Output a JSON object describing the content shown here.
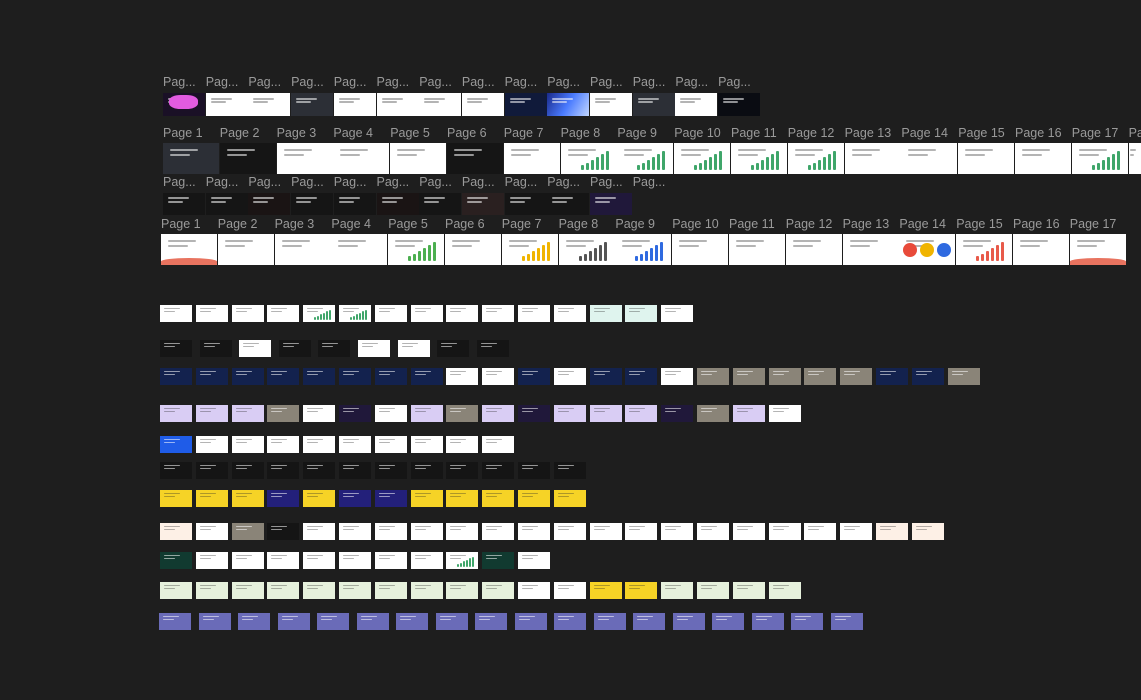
{
  "canvas": {
    "background": "#1e1e1e",
    "label_color": "#9a9a9a"
  },
  "frame_rows": [
    {
      "name": "row-1",
      "labels": [
        "Pag...",
        "Pag...",
        "Pag...",
        "Pag...",
        "Pag...",
        "Pag...",
        "Pag...",
        "Pag...",
        "Pag...",
        "Pag...",
        "Pag...",
        "Pag...",
        "Pag...",
        "Pag..."
      ],
      "thumb_themes": [
        "pink-dark",
        "light",
        "light",
        "photo-dark",
        "light",
        "light",
        "light",
        "light",
        "blue-dark",
        "blue-gradient",
        "light",
        "photo-dark",
        "light",
        "space-dark"
      ]
    },
    {
      "name": "row-2",
      "labels": [
        "Page 1",
        "Page 2",
        "Page 3",
        "Page 4",
        "Page 5",
        "Page 6",
        "Page 7",
        "Page 8",
        "Page 9",
        "Page 10",
        "Page 11",
        "Page 12",
        "Page 13",
        "Page 14",
        "Page 15",
        "Page 16",
        "Page 17",
        "Pa"
      ],
      "thumb_themes": [
        "photo-dark",
        "dark",
        "light",
        "light",
        "light",
        "dark",
        "light",
        "light-chart",
        "light-chart",
        "light-chart",
        "light-chart",
        "light-chart",
        "light",
        "light",
        "light",
        "light",
        "light-chart",
        "light"
      ]
    },
    {
      "name": "row-3",
      "labels": [
        "Pag...",
        "Pag...",
        "Pag...",
        "Pag...",
        "Pag...",
        "Pag...",
        "Pag...",
        "Pag...",
        "Pag...",
        "Pag...",
        "Pag...",
        "Pag..."
      ],
      "thumb_themes": [
        "dark",
        "dark",
        "dark-red",
        "dark",
        "dark",
        "dark-red",
        "dark",
        "red-green",
        "dark",
        "dark",
        "purple-dark"
      ]
    },
    {
      "name": "row-4",
      "labels": [
        "Page 1",
        "Page 2",
        "Page 3",
        "Page 4",
        "Page 5",
        "Page 6",
        "Page 7",
        "Page 8",
        "Page 9",
        "Page 10",
        "Page 11",
        "Page 12",
        "Page 13",
        "Page 14",
        "Page 15",
        "Page 16",
        "Page 17"
      ],
      "thumb_themes": [
        "coral-wave",
        "light",
        "light",
        "light",
        "green-bars",
        "light",
        "yellow-bars",
        "mono-bars",
        "blue-bars",
        "light",
        "light",
        "light",
        "light",
        "circles",
        "coral-bars",
        "people",
        "coral-wave"
      ]
    }
  ],
  "slide_rows": [
    {
      "name": "deck-a",
      "thumb_themes": [
        "light",
        "light",
        "light",
        "light",
        "light-chart",
        "light-chart",
        "light",
        "light",
        "light",
        "light",
        "light",
        "light",
        "teal",
        "teal",
        "light"
      ]
    },
    {
      "name": "deck-b",
      "thumb_themes": [
        "dark",
        "dark",
        "light",
        "dark",
        "dark",
        "light",
        "light",
        "dark",
        "dark"
      ]
    },
    {
      "name": "deck-c",
      "thumb_themes": [
        "navy",
        "navy",
        "navy",
        "navy",
        "navy",
        "navy",
        "navy",
        "navy",
        "light",
        "light",
        "navy",
        "light",
        "navy",
        "navy",
        "light",
        "photo",
        "photo",
        "photo",
        "photo",
        "photo",
        "navy",
        "navy",
        "photo"
      ]
    },
    {
      "name": "deck-d",
      "thumb_themes": [
        "lavender",
        "lavender",
        "lavender",
        "photo",
        "light",
        "purple-dark",
        "light",
        "lavender",
        "photo",
        "lavender",
        "purple-dark",
        "lavender",
        "lavender",
        "lavender",
        "purple-dark",
        "photo",
        "lavender",
        "light"
      ]
    },
    {
      "name": "deck-e",
      "thumb_themes": [
        "blue",
        "light",
        "light",
        "light",
        "light",
        "light",
        "light",
        "light",
        "light",
        "light"
      ]
    },
    {
      "name": "deck-f",
      "thumb_themes": [
        "dark",
        "dark",
        "dark",
        "dark",
        "dark",
        "dark",
        "dark",
        "dark",
        "dark",
        "dark",
        "dark",
        "dark"
      ]
    },
    {
      "name": "deck-g",
      "thumb_themes": [
        "yellow",
        "yellow",
        "yellow",
        "indigo",
        "yellow",
        "indigo",
        "indigo",
        "yellow",
        "yellow",
        "yellow",
        "yellow",
        "yellow"
      ]
    },
    {
      "name": "deck-h",
      "thumb_themes": [
        "peach",
        "light",
        "photo",
        "dark",
        "light",
        "light",
        "light",
        "light",
        "light",
        "light",
        "light",
        "light",
        "light",
        "light",
        "light",
        "light",
        "light",
        "light",
        "light",
        "light",
        "peach",
        "peach"
      ]
    },
    {
      "name": "deck-i",
      "thumb_themes": [
        "green-dark",
        "light",
        "light",
        "light",
        "light",
        "light",
        "light",
        "light",
        "light-chart",
        "green-dark",
        "light"
      ]
    },
    {
      "name": "deck-j",
      "thumb_themes": [
        "mint",
        "mint",
        "mint",
        "mint",
        "mint",
        "mint",
        "mint",
        "mint",
        "mint",
        "mint",
        "light",
        "light",
        "yellow",
        "yellow",
        "mint",
        "mint",
        "mint",
        "mint"
      ]
    },
    {
      "name": "deck-k",
      "thumb_themes": [
        "periwinkle",
        "periwinkle",
        "periwinkle",
        "periwinkle",
        "periwinkle",
        "periwinkle",
        "periwinkle",
        "periwinkle",
        "periwinkle",
        "periwinkle",
        "periwinkle",
        "periwinkle",
        "periwinkle",
        "periwinkle",
        "periwinkle",
        "periwinkle",
        "periwinkle",
        "periwinkle"
      ]
    }
  ],
  "theme_colors": {
    "light": "#ffffff",
    "light-chart": "#ffffff",
    "dark": "#151515",
    "dark-red": "#1a1414",
    "red-green": "#2a2020",
    "purple-dark": "#20183a",
    "pink-dark": "#1a1026",
    "photo-dark": "#2c2f36",
    "space-dark": "#0a0c12",
    "blue-dark": "#101a3a",
    "blue-gradient": "#2c4bd8",
    "coral-wave": "#ffffff",
    "green-bars": "#ffffff",
    "yellow-bars": "#ffffff",
    "mono-bars": "#ffffff",
    "blue-bars": "#ffffff",
    "circles": "#ffffff",
    "coral-bars": "#ffffff",
    "people": "#ffffff",
    "teal": "#dff4ee",
    "navy": "#13224e",
    "photo": "#8a8478",
    "lavender": "#d9cdf4",
    "blue": "#1f5ce8",
    "yellow": "#f6d326",
    "indigo": "#23207a",
    "peach": "#fdf0e6",
    "green-dark": "#113a30",
    "mint": "#e6f1dc",
    "periwinkle": "#6a6bb8"
  }
}
